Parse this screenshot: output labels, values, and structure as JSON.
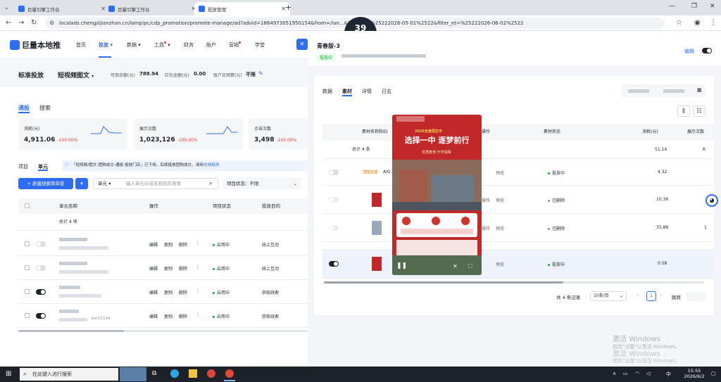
{
  "browser": {
    "tabs": [
      {
        "label": "巨量引擎工作台"
      },
      {
        "label": "巨量引擎工作台"
      },
      {
        "label": "投放管理"
      }
    ],
    "url": "localads.chengzijianzhan.cn/lamp/pc/cdp_promotion/promote-manage/ad?advid=1864973051950154&from=/lan...&filter_st=%25222026-05-01%2522&filter_et=%25222026-06-02%2522"
  },
  "timer": {
    "value": "39",
    "unit": "ms"
  },
  "nav": {
    "logo": "巨量本地推",
    "items": [
      {
        "label": "首页"
      },
      {
        "label": "投放"
      },
      {
        "label": "数据"
      },
      {
        "label": "工具"
      },
      {
        "label": "财务"
      },
      {
        "label": "账户"
      },
      {
        "label": "营销"
      },
      {
        "label": "学堂"
      }
    ]
  },
  "subhead": {
    "mode": "标准投放",
    "type": "短视频图文",
    "balance_label": "可用余额(元)",
    "balance": "788.94",
    "red_label": "红包金额(元)",
    "red": "0.00",
    "budget_label": "账户日预算(元)",
    "budget": "不限"
  },
  "main": {
    "tabs": [
      {
        "label": "通投"
      },
      {
        "label": "搜索"
      }
    ],
    "metrics": [
      {
        "label": "消耗(元)",
        "value": "4,911.06",
        "change": "-100.00%"
      },
      {
        "label": "展示次数",
        "value": "1,023,126",
        "change": "-100.00%"
      },
      {
        "label": "点击次数",
        "value": "3,498",
        "change": "-100.00%"
      }
    ],
    "level_tabs": [
      {
        "label": "项目"
      },
      {
        "label": "单元"
      }
    ],
    "notice": "「短视频/图文-团购成交-通投-投放门店」已下线，后续投放团购成交，请用",
    "notice_link": "全域投放",
    "new_button": "+ 新建线索简单投",
    "filter_select": "单元",
    "search_placeholder": "输入单元ID或名称回车搜索",
    "status_label": "项目状态：",
    "status_value": "不限",
    "columns": [
      "单元名称",
      "操作",
      "项目状态",
      "投放目的"
    ],
    "total": "总计 4 项",
    "rows": [
      {
        "ops": [
          "编辑",
          "复制",
          "删除"
        ],
        "status": "启用中",
        "purpose": "线上互动",
        "on": false,
        "name_hint": ""
      },
      {
        "ops": [
          "编辑",
          "复制",
          "删除"
        ],
        "status": "启用中",
        "purpose": "线上互动",
        "on": false,
        "name_hint": ""
      },
      {
        "ops": [
          "编辑",
          "复制",
          "删除"
        ],
        "status": "启用中",
        "purpose": "获取线索",
        "on": true,
        "name_hint": ""
      },
      {
        "ops": [
          "编辑",
          "复制",
          "删除"
        ],
        "status": "启用中",
        "purpose": "获取线索",
        "on": true,
        "name_hint": "per11144"
      }
    ]
  },
  "drawer": {
    "title": "青春版-3",
    "status": "投放中",
    "edit_label": "编辑",
    "tabs": [
      {
        "label": "数据"
      },
      {
        "label": "素材"
      },
      {
        "label": "详情"
      },
      {
        "label": "日志"
      }
    ],
    "columns": [
      "素材名称和ID",
      "操作",
      "素材状态",
      "消耗(元)",
      "展示次数"
    ],
    "total": "总计 4 条",
    "total_cost": "51.14",
    "total_show": "6",
    "rows": [
      {
        "tag": "智能生成",
        "name": "AIG",
        "op": "预览",
        "status": "投放中",
        "status_color": "#00b42a",
        "cost": "4.32",
        "show": "",
        "on": true
      },
      {
        "tag": "",
        "name": "",
        "op": "预览",
        "status": "已删除",
        "status_color": "#86909c",
        "cost": "10.36",
        "show": "",
        "on": false
      },
      {
        "tag": "",
        "name": "",
        "op": "预览",
        "status": "已删除",
        "status_color": "#86909c",
        "cost": "35.88",
        "show": "1",
        "on": false
      },
      {
        "tag": "",
        "name": "",
        "op": "预览",
        "status": "投放中",
        "status_color": "#00b42a",
        "cost": "0.58",
        "show": "",
        "on": true
      }
    ],
    "ops_hint": "操作",
    "pagination": {
      "total": "共 4 条记录",
      "page_size": "10条/页",
      "page": "1",
      "jump": "跳转"
    }
  },
  "video": {
    "badge": "2026全省招生中",
    "headline": "选择一中 逐梦前行",
    "sub": "优质教育 升学保障"
  },
  "watermark": {
    "line1": "激活 Windows",
    "line2": "转到\"设置\"以激活 Windows。"
  },
  "taskbar": {
    "search_placeholder": "在此键入进行搜索",
    "time": "15:55",
    "date": "2026/6/2",
    "lang": "中"
  }
}
